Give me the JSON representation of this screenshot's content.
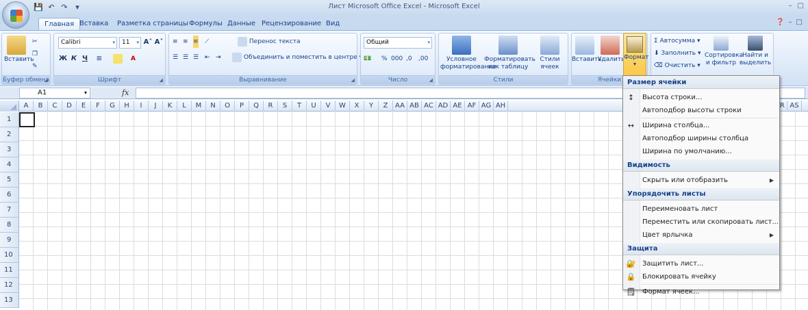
{
  "window": {
    "title": "Лист Microsoft Office Excel - Microsoft Excel"
  },
  "tabs": [
    "Главная",
    "Вставка",
    "Разметка страницы",
    "Формулы",
    "Данные",
    "Рецензирование",
    "Вид"
  ],
  "ribbon": {
    "clipboard": {
      "label": "Буфер обмена",
      "paste": "Вставить"
    },
    "font": {
      "label": "Шрифт",
      "name": "Calibri",
      "size": "11",
      "bold": "Ж",
      "italic": "К",
      "underline": "Ч"
    },
    "alignment": {
      "label": "Выравнивание",
      "wrap": "Перенос текста",
      "merge": "Объединить и поместить в центре"
    },
    "number": {
      "label": "Число",
      "format": "Общий",
      "percent": "%",
      "thousands": "000",
      "inc_dec": ",0",
      "dec_dec": ",00"
    },
    "styles": {
      "label": "Стили",
      "conditional": "Условное форматирование",
      "as_table": "Форматировать как таблицу",
      "cell_styles": "Стили ячеек"
    },
    "cells": {
      "label": "Ячейки",
      "insert": "Вставить",
      "delete": "Удалить",
      "format": "Формат"
    },
    "editing": {
      "autosum": "Автосумма",
      "fill": "Заполнить",
      "clear": "Очистить",
      "sort": "Сортировка и фильтр",
      "find": "Найти и выделить"
    }
  },
  "formula_bar": {
    "name_box": "A1",
    "fx": "fx"
  },
  "columns": [
    "A",
    "B",
    "C",
    "D",
    "E",
    "F",
    "G",
    "H",
    "I",
    "J",
    "K",
    "L",
    "M",
    "N",
    "O",
    "P",
    "Q",
    "R",
    "S",
    "T",
    "U",
    "V",
    "W",
    "X",
    "Y",
    "Z",
    "AA",
    "AB",
    "AC",
    "AD",
    "AE",
    "AF",
    "AG",
    "AH",
    "AQ",
    "AR",
    "AS"
  ],
  "rows": [
    "1",
    "2",
    "3",
    "4",
    "5",
    "6",
    "7",
    "8",
    "9",
    "10",
    "11",
    "12",
    "13"
  ],
  "format_menu": {
    "sections": [
      {
        "header": "Размер ячейки",
        "items": [
          {
            "label": "Высота строки...",
            "icon": "row-height-icon"
          },
          {
            "label": "Автоподбор высоты строки"
          },
          {
            "label": "Ширина столбца...",
            "icon": "col-width-icon"
          },
          {
            "label": "Автоподбор ширины столбца"
          },
          {
            "label": "Ширина по умолчанию..."
          }
        ]
      },
      {
        "header": "Видимость",
        "items": [
          {
            "label": "Скрыть или отобразить",
            "submenu": true
          }
        ]
      },
      {
        "header": "Упорядочить листы",
        "items": [
          {
            "label": "Переименовать лист"
          },
          {
            "label": "Переместить или скопировать лист..."
          },
          {
            "label": "Цвет ярлычка",
            "submenu": true
          }
        ]
      },
      {
        "header": "Защита",
        "items": [
          {
            "label": "Защитить лист...",
            "icon": "protect-sheet-icon"
          },
          {
            "label": "Блокировать ячейку",
            "icon": "lock-icon"
          },
          {
            "label": "Формат ячеек...",
            "icon": "format-cells-icon"
          }
        ]
      }
    ]
  }
}
